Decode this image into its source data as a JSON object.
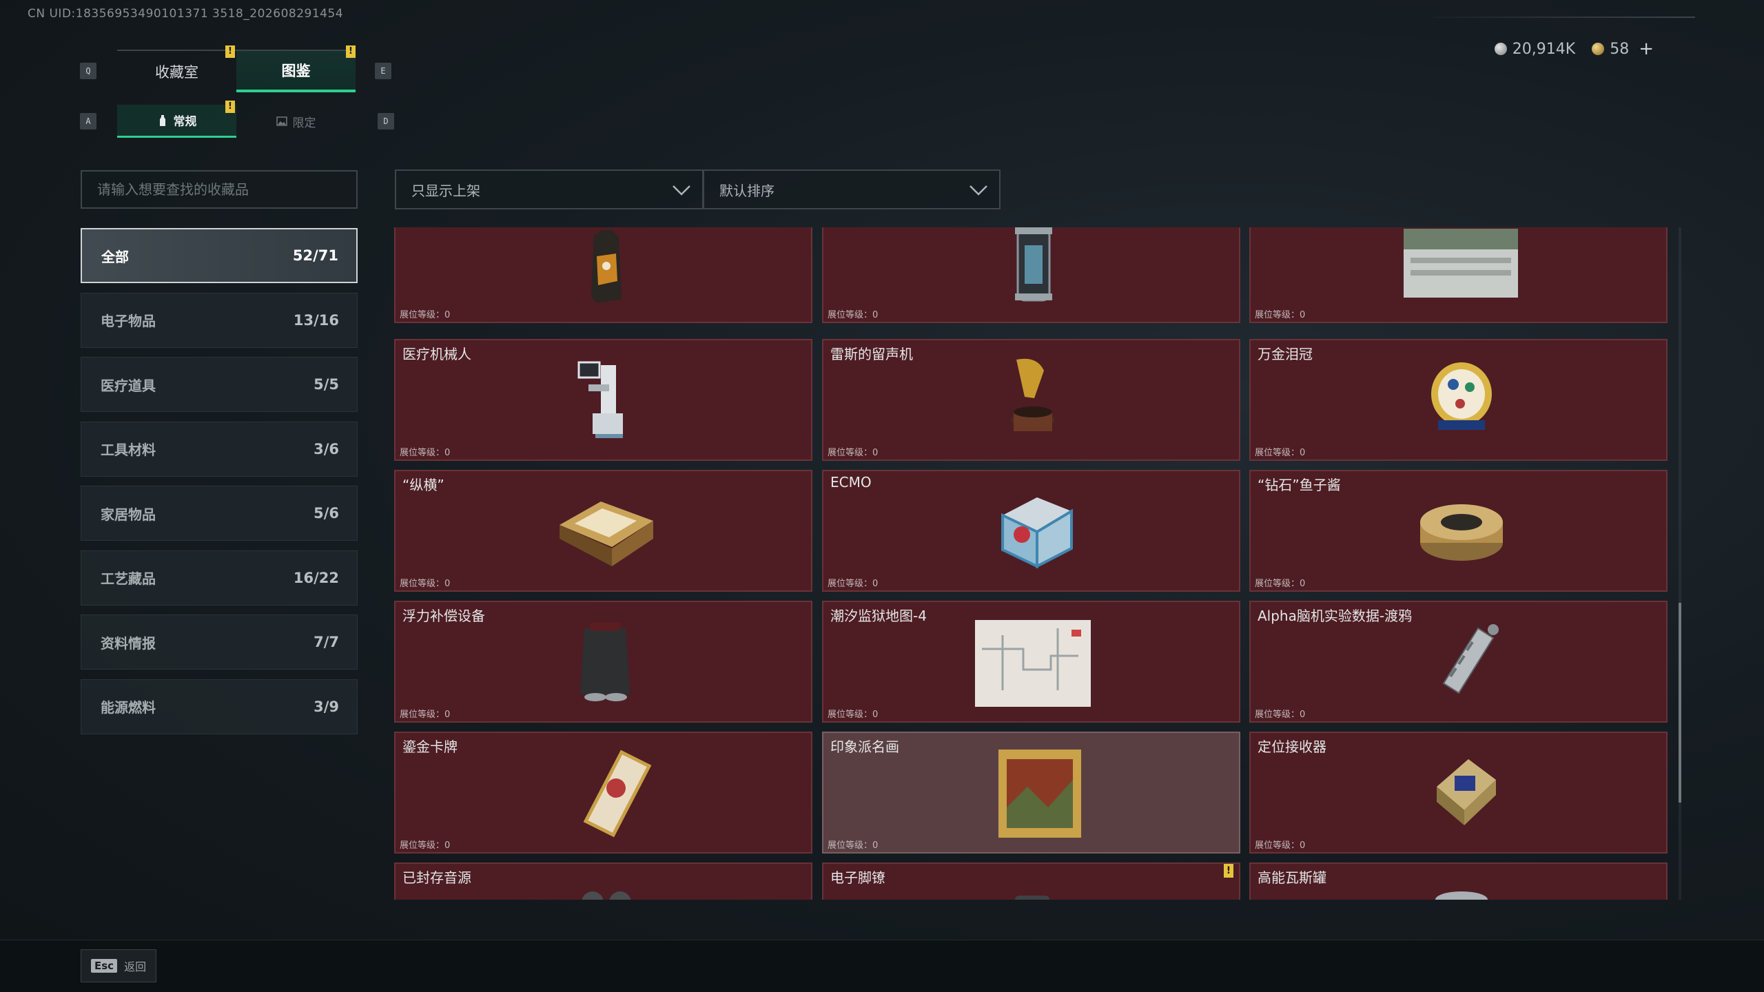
{
  "uid_text": "CN UID:18356953490101371 3518_202608291454",
  "currency": {
    "silver": "20,914K",
    "gold": "58",
    "plus": "+"
  },
  "keys": {
    "q": "Q",
    "e": "E",
    "a": "A",
    "d": "D"
  },
  "main_tabs": [
    {
      "label": "收藏室",
      "badge": "!"
    },
    {
      "label": "图鉴",
      "badge": "!"
    }
  ],
  "sub_tabs": [
    {
      "label": "常规",
      "badge": "!"
    },
    {
      "label": "限定"
    }
  ],
  "search": {
    "placeholder": "请输入想要查找的收藏品"
  },
  "filters": {
    "display": "只显示上架",
    "sort": "默认排序"
  },
  "categories": [
    {
      "label": "全部",
      "count": "52/71"
    },
    {
      "label": "电子物品",
      "count": "13/16"
    },
    {
      "label": "医疗道具",
      "count": "5/5"
    },
    {
      "label": "工具材料",
      "count": "3/6"
    },
    {
      "label": "家居物品",
      "count": "5/6"
    },
    {
      "label": "工艺藏品",
      "count": "16/22"
    },
    {
      "label": "资料情报",
      "count": "7/7"
    },
    {
      "label": "能源燃料",
      "count": "3/9"
    }
  ],
  "level_label": "展位等级：0",
  "items": [
    {
      "name": "",
      "icon": "coffee-bag-icon"
    },
    {
      "name": "",
      "icon": "reactor-core-icon"
    },
    {
      "name": "",
      "icon": "server-box-icon"
    },
    {
      "name": "医疗机械人",
      "icon": "medical-robot-icon"
    },
    {
      "name": "雷斯的留声机",
      "icon": "gramophone-icon"
    },
    {
      "name": "万金泪冠",
      "icon": "jeweled-egg-icon"
    },
    {
      "name": "“纵横”",
      "icon": "chess-board-icon"
    },
    {
      "name": "ECMO",
      "icon": "ecmo-machine-icon"
    },
    {
      "name": "“钻石”鱼子酱",
      "icon": "caviar-tin-icon"
    },
    {
      "name": "浮力补偿设备",
      "icon": "buoyancy-device-icon"
    },
    {
      "name": "潮汐监狱地图-4",
      "icon": "prison-map-icon"
    },
    {
      "name": "Alpha脑机实验数据-渡鸦",
      "icon": "data-canister-icon"
    },
    {
      "name": "鎏金卡牌",
      "icon": "gilded-card-icon"
    },
    {
      "name": "印象派名画",
      "icon": "framed-painting-icon"
    },
    {
      "name": "定位接收器",
      "icon": "receiver-icon"
    },
    {
      "name": "已封存音源",
      "icon": "sealed-audio-icon"
    },
    {
      "name": "电子脚镣",
      "icon": "ankle-monitor-icon",
      "badge": "!"
    },
    {
      "name": "高能瓦斯罐",
      "icon": "gas-tank-icon"
    }
  ],
  "back": {
    "key": "Esc",
    "label": "返回"
  },
  "colors": {
    "accent": "#2fcf8e",
    "card_bg": "#4d1d23",
    "badge": "#e7c43a"
  }
}
